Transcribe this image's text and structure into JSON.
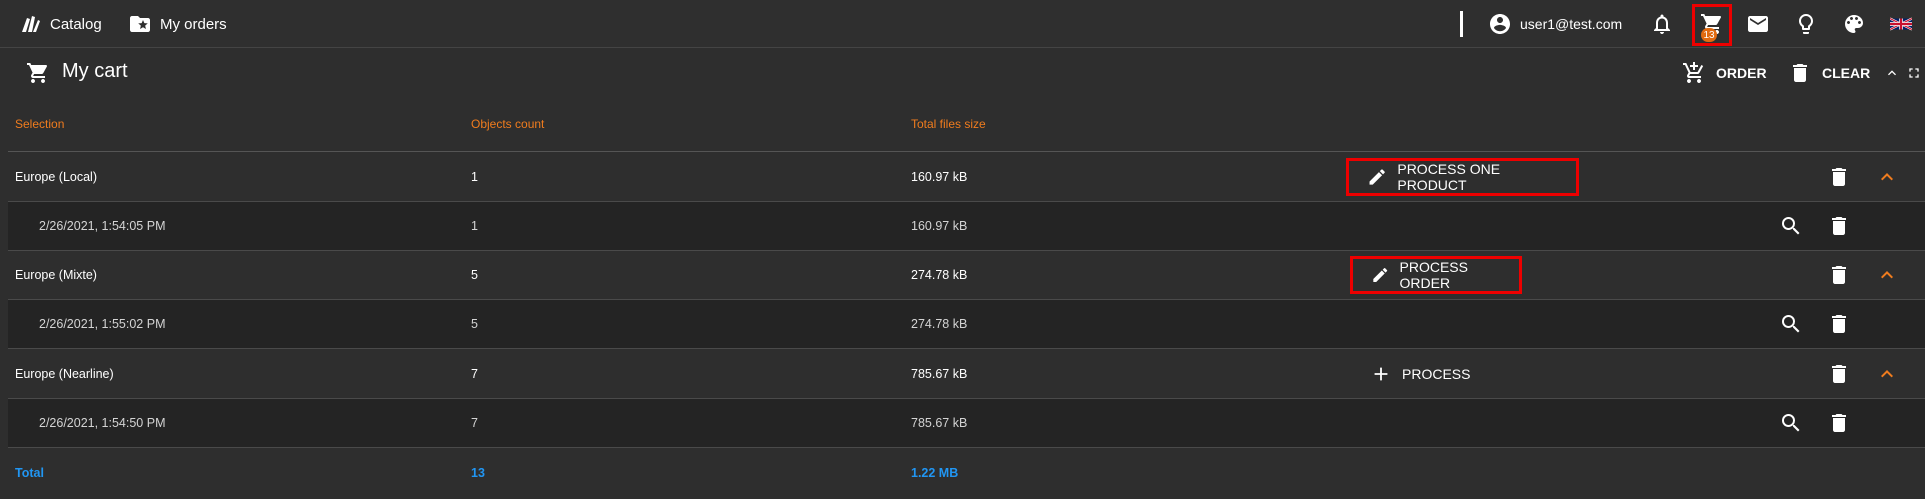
{
  "nav": {
    "catalog_label": "Catalog",
    "orders_label": "My orders",
    "user_email": "user1@test.com",
    "cart_count": "13"
  },
  "header": {
    "title": "My cart",
    "order_label": "ORDER",
    "clear_label": "CLEAR"
  },
  "table": {
    "columns": [
      "Selection",
      "Objects count",
      "Total files size"
    ],
    "rows": [
      {
        "kind": "group",
        "selection": "Europe (Local)",
        "count": "1",
        "size": "160.97 kB",
        "action": "PROCESS ONE PRODUCT"
      },
      {
        "kind": "sub",
        "selection": "2/26/2021, 1:54:05 PM",
        "count": "1",
        "size": "160.97 kB"
      },
      {
        "kind": "group",
        "selection": "Europe (Mixte)",
        "count": "5",
        "size": "274.78 kB",
        "action": "PROCESS ORDER"
      },
      {
        "kind": "sub",
        "selection": "2/26/2021, 1:55:02 PM",
        "count": "5",
        "size": "274.78 kB"
      },
      {
        "kind": "group",
        "selection": "Europe (Nearline)",
        "count": "7",
        "size": "785.67 kB",
        "action": "PROCESS"
      },
      {
        "kind": "sub",
        "selection": "2/26/2021, 1:54:50 PM",
        "count": "7",
        "size": "785.67 kB"
      }
    ],
    "total": {
      "label": "Total",
      "count": "13",
      "size": "1.22 MB"
    }
  },
  "colors": {
    "accent": "#f07c1e",
    "total": "#2196f3",
    "highlight": "#e00000",
    "background": "#2e2e2e"
  },
  "icons": [
    "catalog-icon",
    "folder-star-icon",
    "account-circle-icon",
    "bell-icon",
    "cart-icon",
    "mail-icon",
    "lightbulb-icon",
    "palette-icon",
    "uk-flag-icon",
    "cart-arrow-down-icon",
    "delete-icon",
    "chevron-up-icon",
    "fullscreen-icon",
    "pencil-icon",
    "plus-icon",
    "search-icon"
  ]
}
